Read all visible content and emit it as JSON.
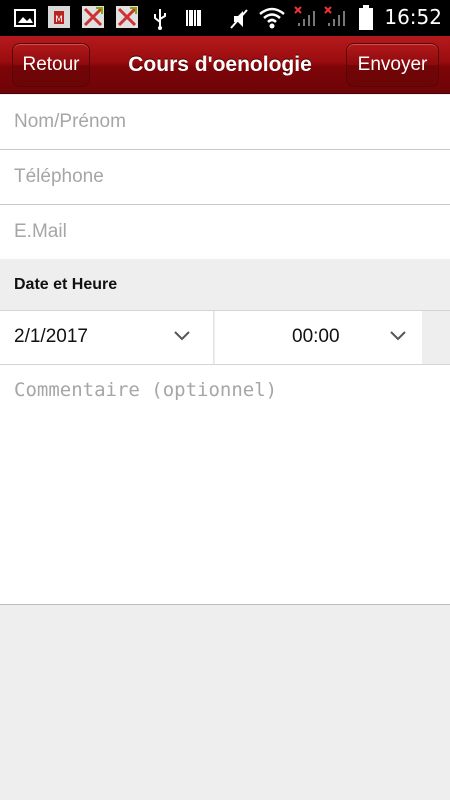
{
  "status_bar": {
    "time": "16:52",
    "icons": [
      "gallery-icon",
      "app-icon",
      "app-icon",
      "app-icon",
      "usb-icon",
      "barcode-icon",
      "mute-icon",
      "wifi-icon",
      "signal-off-icon",
      "signal-off-icon",
      "battery-icon"
    ]
  },
  "header": {
    "back_label": "Retour",
    "title": "Cours d'oenologie",
    "send_label": "Envoyer",
    "color": "#8c0a0d"
  },
  "form": {
    "name_placeholder": "Nom/Prénom",
    "phone_placeholder": "Téléphone",
    "email_placeholder": "E.Mail",
    "date_section_label": "Date et Heure",
    "date_value": "2/1/2017",
    "time_value": "00:00",
    "comment_placeholder": "Commentaire (optionnel)"
  }
}
